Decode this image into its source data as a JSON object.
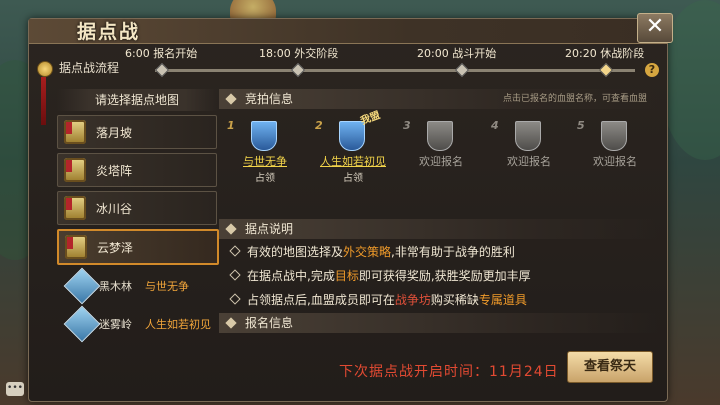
{
  "window": {
    "title": "据点战"
  },
  "flow": {
    "label": "据点战流程",
    "stages": [
      {
        "time_label": "6:00 报名开始",
        "active": false
      },
      {
        "time_label": "18:00 外交阶段",
        "active": false
      },
      {
        "time_label": "20:00 战斗开始",
        "active": false
      },
      {
        "time_label": "20:20 休战阶段",
        "active": true
      }
    ]
  },
  "maps": {
    "header": "请选择据点地图",
    "items": [
      {
        "name": "落月坡",
        "selected": false
      },
      {
        "name": "炎塔阵",
        "selected": false
      },
      {
        "name": "冰川谷",
        "selected": false
      },
      {
        "name": "云梦泽",
        "selected": true
      }
    ],
    "sub_items": [
      {
        "name": "黑木林",
        "owner": "与世无争"
      },
      {
        "name": "迷雾岭",
        "owner": "人生如若初见"
      }
    ]
  },
  "auction": {
    "header": "竞拍信息",
    "hint": "点击已报名的血盟名称，可查看血盟",
    "my_tag": "我盟",
    "slots": [
      {
        "num": "1",
        "name": "与世无争",
        "status": "占领",
        "owned": true
      },
      {
        "num": "2",
        "name": "人生如若初见",
        "status": "占领",
        "owned": true
      },
      {
        "num": "3",
        "name": "欢迎报名",
        "status": "",
        "owned": false
      },
      {
        "num": "4",
        "name": "欢迎报名",
        "status": "",
        "owned": false
      },
      {
        "num": "5",
        "name": "欢迎报名",
        "status": "",
        "owned": false
      }
    ]
  },
  "rules": {
    "header": "据点说明",
    "line1": {
      "a": "有效的地图选择及",
      "b": "外交策略",
      "c": ",非常有助于战争的胜利"
    },
    "line2": {
      "a": "在据点战中,完成",
      "b": "目标",
      "c": "即可获得奖励,获胜奖励更加丰厚"
    },
    "line3": {
      "a": "占领据点后,血盟成员即可在",
      "b": "战争坊",
      "c": "购买稀缺",
      "d": "专属道具"
    }
  },
  "signup": {
    "header": "报名信息",
    "next_time": "下次据点战开启时间：11月24日",
    "view_button": "查看祭天"
  },
  "colors": {
    "accent": "#d28a2a",
    "highlight": "#ef9a2a",
    "alert": "#e24a32",
    "owner": "#f3d44a"
  }
}
